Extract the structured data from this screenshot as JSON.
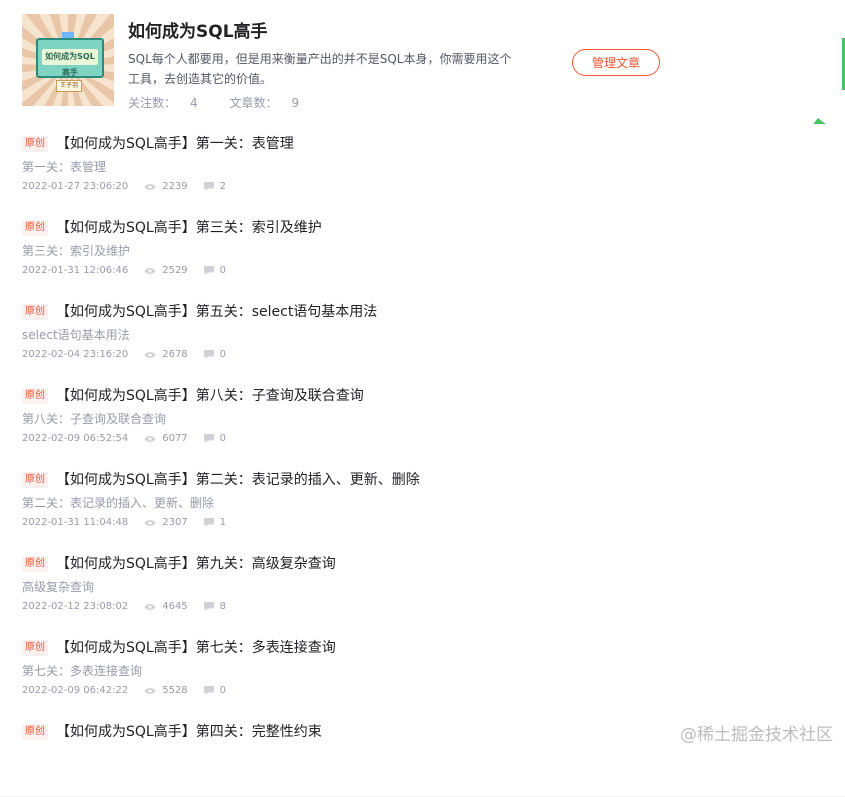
{
  "column": {
    "cover_text": "如何成为SQL高手",
    "cover_tag": "王子羽",
    "title": "如何成为SQL高手",
    "description": "SQL每个人都要用，但是用来衡量产出的并不是SQL本身，你需要用这个工具，去创造其它的价值。",
    "followers_label": "关注数：",
    "followers": "4",
    "articles_label": "文章数：",
    "articles": "9",
    "manage_button": "管理文章"
  },
  "articles": [
    {
      "badge": "原创",
      "title": "【如何成为SQL高手】第一关：表管理",
      "desc": "第一关：表管理",
      "date": "2022-01-27 23:06:20",
      "views": "2239",
      "comments": "2"
    },
    {
      "badge": "原创",
      "title": "【如何成为SQL高手】第三关：索引及维护",
      "desc": "第三关：索引及维护",
      "date": "2022-01-31 12:06:46",
      "views": "2529",
      "comments": "0"
    },
    {
      "badge": "原创",
      "title": "【如何成为SQL高手】第五关：select语句基本用法",
      "desc": "select语句基本用法",
      "date": "2022-02-04 23:16:20",
      "views": "2678",
      "comments": "0"
    },
    {
      "badge": "原创",
      "title": "【如何成为SQL高手】第八关：子查询及联合查询",
      "desc": "第八关：子查询及联合查询",
      "date": "2022-02-09 06:52:54",
      "views": "6077",
      "comments": "0"
    },
    {
      "badge": "原创",
      "title": "【如何成为SQL高手】第二关：表记录的插入、更新、删除",
      "desc": "第二关：表记录的插入、更新、删除",
      "date": "2022-01-31 11:04:48",
      "views": "2307",
      "comments": "1"
    },
    {
      "badge": "原创",
      "title": "【如何成为SQL高手】第九关：高级复杂查询",
      "desc": "高级复杂查询",
      "date": "2022-02-12 23:08:02",
      "views": "4645",
      "comments": "8"
    },
    {
      "badge": "原创",
      "title": "【如何成为SQL高手】第七关：多表连接查询",
      "desc": "第七关：多表连接查询",
      "date": "2022-02-09 06:42:22",
      "views": "5528",
      "comments": "0"
    },
    {
      "badge": "原创",
      "title": "【如何成为SQL高手】第四关：完整性约束",
      "desc": "",
      "date": "",
      "views": "",
      "comments": ""
    }
  ],
  "watermark": "@稀土掘金技术社区",
  "colors": {
    "accent": "#fc5531",
    "meta": "#999aaa",
    "title": "#222226",
    "badge_green": "#4cc262"
  }
}
